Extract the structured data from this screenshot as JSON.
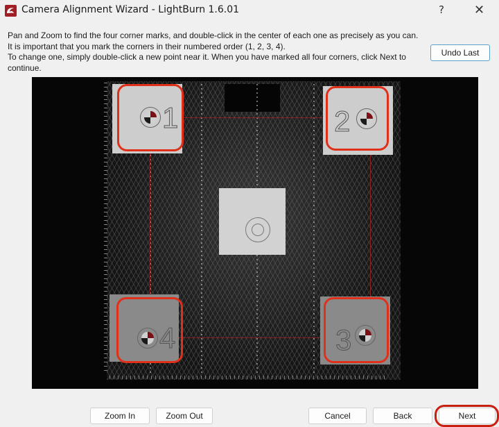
{
  "window": {
    "title": "Camera Alignment Wizard - LightBurn 1.6.01",
    "app_icon": "lightburn-logo-icon",
    "help_label": "?",
    "close_label": "✕"
  },
  "instructions": [
    "Pan and Zoom to find the four corner marks, and double-click in the center of each one as precisely as you can.",
    "It is important that you mark the corners in their numbered order (1, 2, 3, 4).",
    "To change one, simply double-click a new point near it.  When you have marked all four corners, click Next to continue."
  ],
  "buttons": {
    "undo_last": "Undo Last",
    "zoom_in": "Zoom In",
    "zoom_out": "Zoom Out",
    "cancel": "Cancel",
    "back": "Back",
    "next": "Next"
  },
  "camera_view": {
    "corner_marks": [
      {
        "number": "1",
        "position": "top-left"
      },
      {
        "number": "2",
        "position": "top-right"
      },
      {
        "number": "3",
        "position": "bottom-right"
      },
      {
        "number": "4",
        "position": "bottom-left"
      }
    ],
    "highlight_color": "#e0301a"
  }
}
